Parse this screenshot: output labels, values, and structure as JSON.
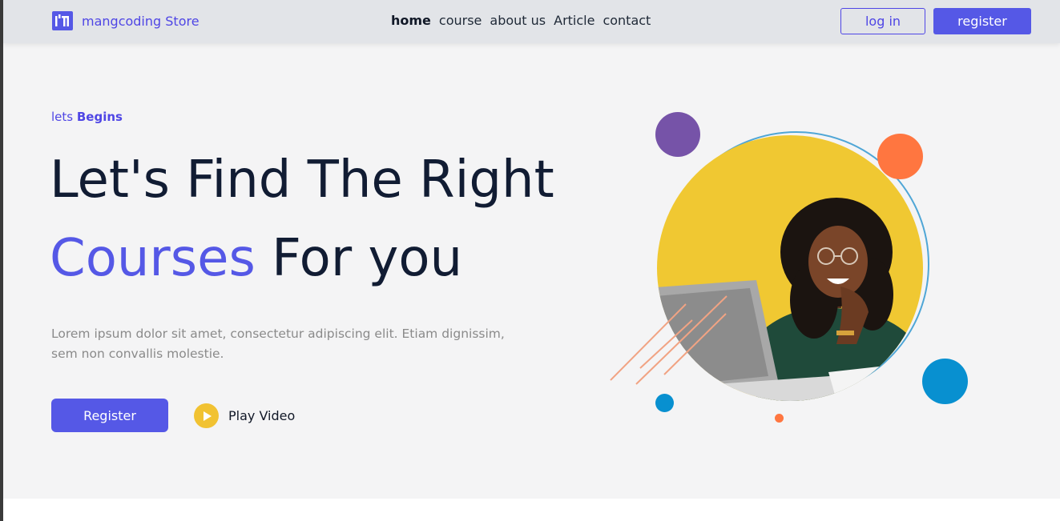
{
  "brand": {
    "name": "mangcoding Store"
  },
  "nav": {
    "links": [
      {
        "label": "home",
        "active": true
      },
      {
        "label": "course",
        "active": false
      },
      {
        "label": "about us",
        "active": false
      },
      {
        "label": "Article",
        "active": false
      },
      {
        "label": "contact",
        "active": false
      }
    ],
    "login_label": "log in",
    "register_label": "register"
  },
  "hero": {
    "eyebrow_prefix": "lets",
    "eyebrow_emphasis": "Begins",
    "headline_line1": "Let's Find The Right",
    "headline_accent": "Courses",
    "headline_rest": "For you",
    "description": "Lorem ipsum dolor sit amet, consectetur adipiscing elit. Etiam dignissim, sem non convallis molestie.",
    "cta_label": "Register",
    "play_label": "Play Video"
  },
  "icons": {
    "brand": "brand-logo-icon",
    "play": "play-icon"
  },
  "colors": {
    "primary": "#5558e6",
    "accent_yellow": "#f1c232",
    "purple": "#7653a8",
    "orange": "#ff7640",
    "blue": "#0890d0",
    "heading": "#111c33"
  }
}
